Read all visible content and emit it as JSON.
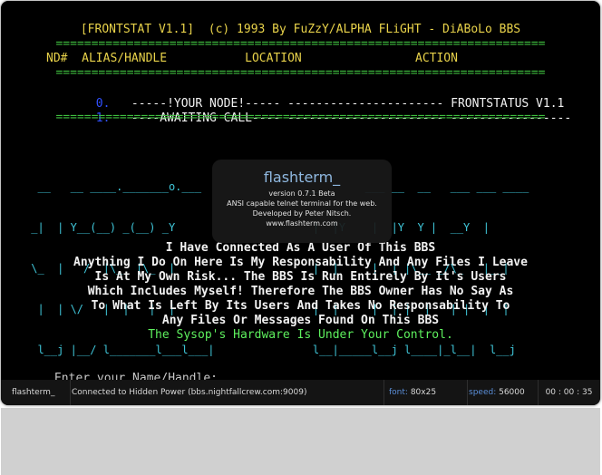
{
  "header": {
    "banner": "[FRONTSTAT V1.1]  (c) 1993 By FuZzY/ALPHA FLiGHT - DiABoLo BBS",
    "separator": "=====================================================================",
    "columns": "ND#  ALIAS/HANDLE           LOCATION                ACTION",
    "node0_num": " 0.",
    "node0_text": "   -----!YOUR NODE!----- ---------------------- FRONTSTATUS V1.1",
    "node1_num": " 1.",
    "node1_text": "   ----AWAITING CALL---- ---------------------- -----------------"
  },
  "logo_lines": [
    "  __   __ ____._______o.___                __       ___ __  __   ___ ___ ____",
    " _|  | Y__(__) _(__) _Y                     |  |Y    |  |Y  Y |  __Y  |",
    " \\_  |   /  |\\_  |\\_  |                     |  |     |  | |\\__ _/\\_   |__|",
    "  |  | \\/   |  |   |  |                     |  |     |  | |  |   | |  |  |",
    "  l__j |__/ l_______l___l___|               l__|_____l__j l____|_l__|  l__j",
    "    `--'                                                   `-'"
  ],
  "message": {
    "line1": "I Have Connected As A User Of This BBS",
    "line2": "Anything I Do On Here Is My Responsability And Any Files I Leave",
    "line3": "Is At My Own Risk... The BBS Is Run Entirely By It's Users",
    "line4": "Which Includes Myself! Therefore The BBS Owner Has No Say As",
    "line5": "To What Is Left By Its Users And Takes No Responsability To",
    "line6": "Any Files Or Messages Found On This BBS",
    "line7": "The Sysop's Hardware Is Under Your Control."
  },
  "prompt": {
    "label": "Enter your Name/Handle: ",
    "cursor": "_"
  },
  "about": {
    "title": "flashterm_",
    "version": "version 0.7.1 Beta",
    "description": "ANSI capable telnet terminal for the web.",
    "developer": "Developed by Peter Nitsch.",
    "url": "www.flashterm.com"
  },
  "statusbar": {
    "app": "flashterm_",
    "connection": "Connected to Hidden Power (bbs.nightfallcrew.com:9009)",
    "font_label": "font:",
    "font_value": "80x25",
    "speed_label": "speed:",
    "speed_value": "56000",
    "timer": "00 : 00 : 35"
  },
  "colors": {
    "background": "#000000",
    "banner": "#e8d24a",
    "separator": "#3fbf3f",
    "node_number": "#3050ff",
    "logo": "#3fc6d9",
    "highlight": "#5ef05e",
    "statusbar": "#141414",
    "label_accent": "#5b8fd9"
  }
}
